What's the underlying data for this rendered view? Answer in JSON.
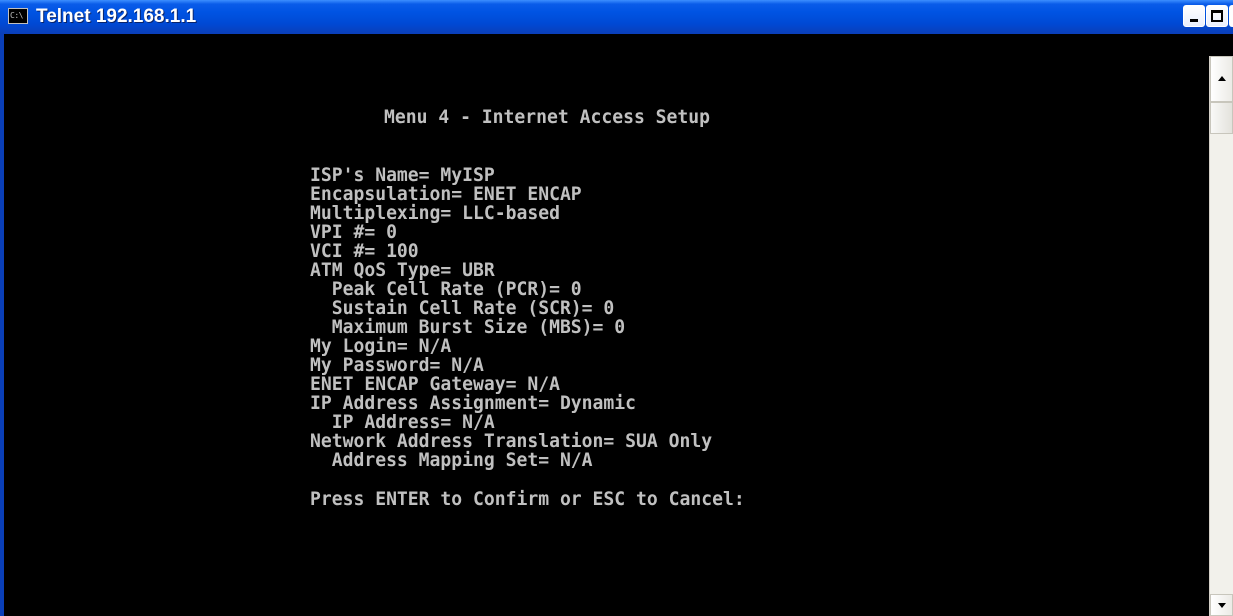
{
  "window": {
    "title": "Telnet 192.168.1.1",
    "icon_text": "C:\\"
  },
  "console": {
    "lines": [
      "Menu 4 - Internet Access Setup",
      "ISP's Name= MyISP",
      "Encapsulation= ENET ENCAP",
      "Multiplexing= LLC-based",
      "VPI #= 0",
      "VCI #= 100",
      "ATM QoS Type= UBR",
      "  Peak Cell Rate (PCR)= 0",
      "  Sustain Cell Rate (SCR)= 0",
      "  Maximum Burst Size (MBS)= 0",
      "My Login= N/A",
      "My Password= N/A",
      "ENET ENCAP Gateway= N/A",
      "IP Address Assignment= Dynamic",
      "  IP Address= N/A",
      "Network Address Translation= SUA Only",
      "  Address Mapping Set= N/A",
      "Press ENTER to Confirm or ESC to Cancel:"
    ]
  },
  "colors": {
    "console_background": "#000000",
    "console_text": "#c0c0c0",
    "titlebar": "#0054e3",
    "title_text": "#ffffff"
  },
  "icons": {
    "app": "console-icon",
    "minimize": "minimize-icon",
    "maximize": "maximize-icon",
    "close": "close-icon",
    "scroll_up": "arrow-up-icon",
    "scroll_down": "arrow-down-icon"
  }
}
